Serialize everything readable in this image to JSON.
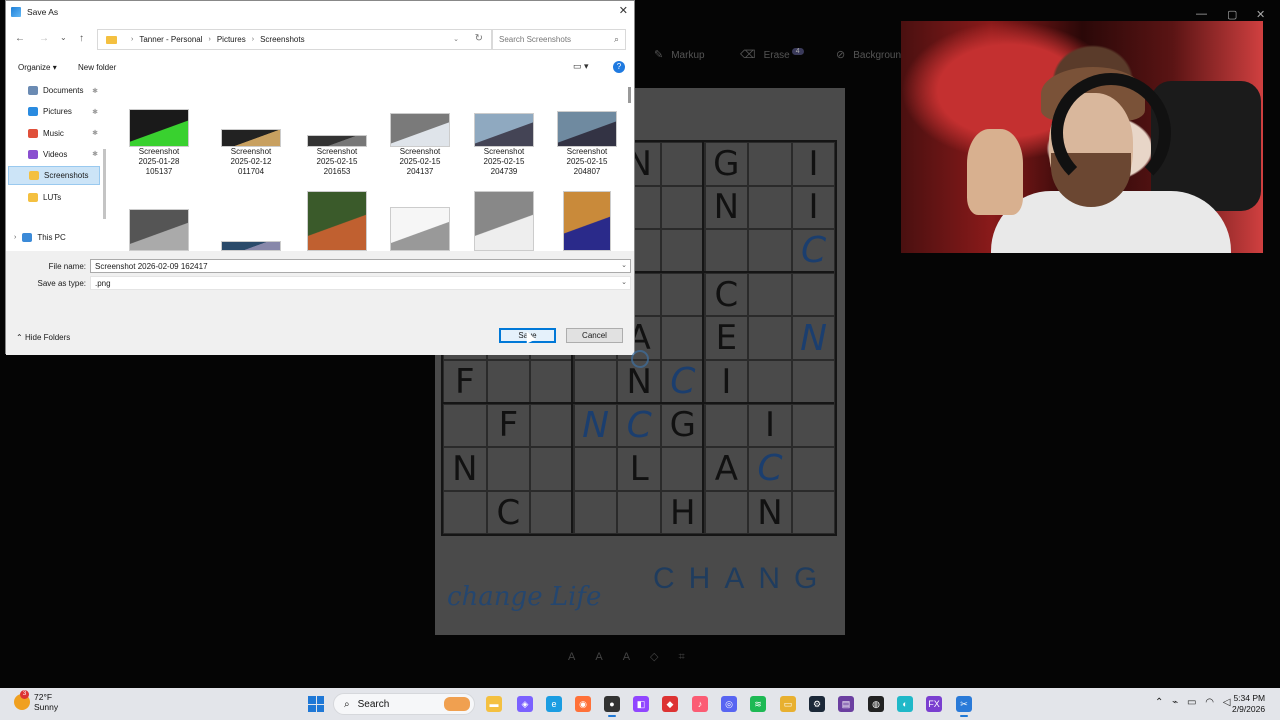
{
  "background_app": {
    "toolbar": {
      "markup_label": "Markup",
      "erase_label": "Erase",
      "erase_badge": "4",
      "background_label": "Background"
    },
    "puzzle": {
      "cells": [
        [
          "",
          "",
          "",
          "",
          "N",
          "",
          "G",
          "",
          "I"
        ],
        [
          "",
          "",
          "",
          "",
          "",
          "",
          "N",
          "",
          "I"
        ],
        [
          "",
          "",
          "",
          "",
          "",
          "",
          "",
          "",
          "C"
        ],
        [
          "",
          "",
          "",
          "",
          "",
          "",
          "C",
          "",
          ""
        ],
        [
          "",
          "",
          "",
          "",
          "A",
          "",
          "E",
          "",
          "N"
        ],
        [
          "F",
          "",
          "",
          "",
          "N",
          "C",
          "I",
          "",
          ""
        ],
        [
          "",
          "F",
          "",
          "N",
          "C",
          "G",
          "",
          "I",
          ""
        ],
        [
          "N",
          "",
          "",
          "",
          "L",
          "",
          "A",
          "C",
          ""
        ],
        [
          "",
          "C",
          "",
          "",
          "",
          "H",
          "",
          "N",
          ""
        ]
      ],
      "handwriting": "change Life",
      "big_text": "CHANG"
    }
  },
  "dialog": {
    "title": "Save As",
    "nav": {
      "back": "←",
      "forward": "→",
      "recent": "⌄",
      "up": "↑"
    },
    "breadcrumb": [
      "Tanner - Personal",
      "Pictures",
      "Screenshots"
    ],
    "search_placeholder": "Search Screenshots",
    "toolbar": {
      "organize": "Organize",
      "new_folder": "New folder"
    },
    "nav_pane": [
      {
        "label": "Documents",
        "icon": "documents-icon",
        "color": "#6b8bb3",
        "pinned": true
      },
      {
        "label": "Pictures",
        "icon": "pictures-icon",
        "color": "#2a8be0",
        "pinned": true
      },
      {
        "label": "Music",
        "icon": "music-icon",
        "color": "#e0503a",
        "pinned": true
      },
      {
        "label": "Videos",
        "icon": "videos-icon",
        "color": "#8a4fd0",
        "pinned": true
      },
      {
        "label": "Screenshots",
        "icon": "folder-icon",
        "color": "#f4c040",
        "pinned": false,
        "selected": true
      },
      {
        "label": "LUTs",
        "icon": "folder-icon",
        "color": "#f4c040",
        "pinned": false
      }
    ],
    "this_pc": "This PC",
    "files": [
      {
        "name": "Screenshot",
        "line2": "2025-01-28",
        "line3": "105137",
        "bg": "#1a1a1a",
        "accent": "#39d12f"
      },
      {
        "name": "Screenshot",
        "line2": "2025-02-12",
        "line3": "011704",
        "bg": "#222",
        "accent": "#c8a060"
      },
      {
        "name": "Screenshot",
        "line2": "2025-02-15",
        "line3": "201653",
        "bg": "#333",
        "accent": "#777"
      },
      {
        "name": "Screenshot",
        "line2": "2025-02-15",
        "line3": "204137",
        "bg": "#7a7a7a",
        "accent": "#dfe4ea"
      },
      {
        "name": "Screenshot",
        "line2": "2025-02-15",
        "line3": "204739",
        "bg": "#8fa9c0",
        "accent": "#445"
      },
      {
        "name": "Screenshot",
        "line2": "2025-02-15",
        "line3": "204807",
        "bg": "#6f8aa0",
        "accent": "#334"
      },
      {
        "name": "",
        "line2": "",
        "line3": "",
        "bg": "#555",
        "accent": "#aaa"
      },
      {
        "name": "",
        "line2": "",
        "line3": "",
        "bg": "#2a4a6a",
        "accent": "#88a"
      },
      {
        "name": "",
        "line2": "",
        "line3": "",
        "bg": "#3a5a2a",
        "accent": "#c06030"
      },
      {
        "name": "",
        "line2": "",
        "line3": "",
        "bg": "#f6f6f6",
        "accent": "#999"
      },
      {
        "name": "",
        "line2": "",
        "line3": "",
        "bg": "#888",
        "accent": "#eee"
      },
      {
        "name": "",
        "line2": "",
        "line3": "",
        "bg": "#c98a3a",
        "accent": "#2a2a8a"
      }
    ],
    "file_name_label": "File name:",
    "file_name_value": "Screenshot 2026-02-09 162417",
    "save_type_label": "Save as type:",
    "save_type_value": ".png",
    "hide_folders": "Hide Folders",
    "save_button": "Save",
    "cancel_button": "Cancel"
  },
  "taskbar": {
    "weather_temp": "72°F",
    "weather_desc": "Sunny",
    "weather_badge": "3",
    "search_label": "Search",
    "time": "5:34 PM",
    "date": "2/9/2026",
    "apps": [
      {
        "name": "file-explorer-icon",
        "color": "#f4c040",
        "glyph": "▬"
      },
      {
        "name": "copilot-icon",
        "color": "#7b61ff",
        "glyph": "◈"
      },
      {
        "name": "edge-icon",
        "color": "#1b9de2",
        "glyph": "e"
      },
      {
        "name": "firefox-icon",
        "color": "#ff7139",
        "glyph": "◉"
      },
      {
        "name": "obs-icon",
        "color": "#333",
        "glyph": "●"
      },
      {
        "name": "twitch-icon",
        "color": "#9146ff",
        "glyph": "◧"
      },
      {
        "name": "app-red-icon",
        "color": "#d33",
        "glyph": "◆"
      },
      {
        "name": "itunes-icon",
        "color": "#fb5c74",
        "glyph": "♪"
      },
      {
        "name": "discord-icon",
        "color": "#5865f2",
        "glyph": "◎"
      },
      {
        "name": "spotify-icon",
        "color": "#1db954",
        "glyph": "≋"
      },
      {
        "name": "folder-app-icon",
        "color": "#e8b030",
        "glyph": "▭"
      },
      {
        "name": "steam-icon",
        "color": "#1b2838",
        "glyph": "⚙"
      },
      {
        "name": "app-purple-icon",
        "color": "#6b3fa0",
        "glyph": "▤"
      },
      {
        "name": "app-dark-icon",
        "color": "#222",
        "glyph": "◍"
      },
      {
        "name": "app-teal-icon",
        "color": "#1fb8c8",
        "glyph": "◐"
      },
      {
        "name": "fx-icon",
        "color": "#7a3fd0",
        "glyph": "FX"
      },
      {
        "name": "snipping-tool-icon",
        "color": "#2a7ad8",
        "glyph": "✂"
      }
    ]
  }
}
